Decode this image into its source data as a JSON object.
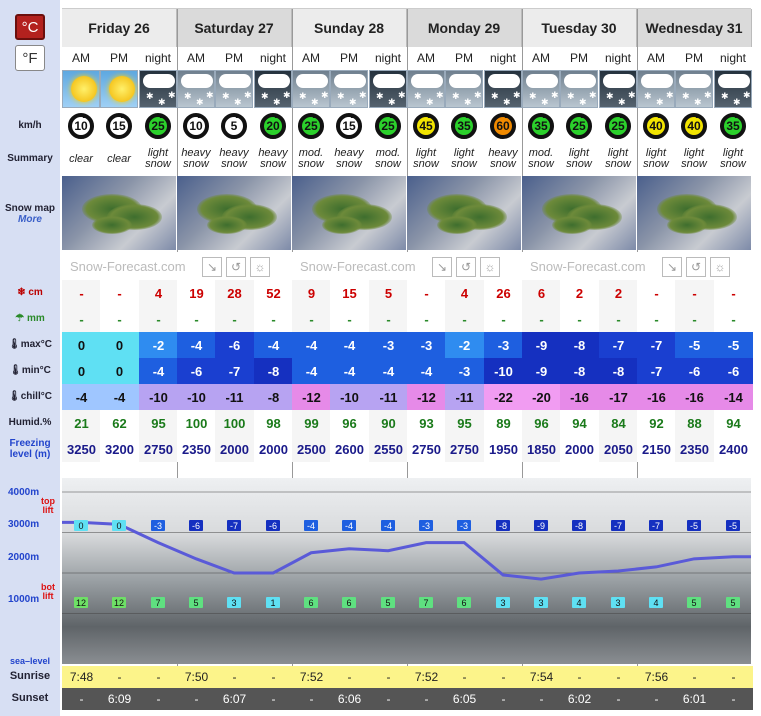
{
  "units": {
    "celsius": "°C",
    "fahrenheit": "°F"
  },
  "labels": {
    "wind": "km/h",
    "summary": "Summary",
    "snowmap": "Snow map",
    "more": "More",
    "snow": "cm",
    "rain": "mm",
    "max": "max°C",
    "min": "min°C",
    "chill": "chill°C",
    "humid": "Humid.%",
    "freezing": "Freezing level (m)",
    "alt4000": "4000m",
    "alt3000": "3000m",
    "alt2000": "2000m",
    "alt1000": "1000m",
    "top": "top",
    "lift": "lift",
    "bot": "bot",
    "sea": "sea–level",
    "sunrise": "Sunrise",
    "sunset": "Sunset"
  },
  "days": [
    "Friday 26",
    "Saturday 27",
    "Sunday 28",
    "Monday 29",
    "Tuesday 30",
    "Wednesday 31"
  ],
  "periods": [
    "AM",
    "PM",
    "night"
  ],
  "credit": "Snow-Forecast.com",
  "weather": [
    "sun",
    "sun",
    "night",
    "snow",
    "snow",
    "night",
    "snow",
    "snow",
    "night",
    "snow",
    "snow",
    "night",
    "snow",
    "snow",
    "night",
    "snow",
    "snow",
    "night"
  ],
  "wind": [
    "10",
    "15",
    "25",
    "10",
    "5",
    "20",
    "25",
    "15",
    "25",
    "45",
    "35",
    "60",
    "35",
    "25",
    "25",
    "40",
    "40",
    "35"
  ],
  "wind_colors": [
    "#fff",
    "#fff",
    "#2bd12b",
    "#fff",
    "#fff",
    "#2bd12b",
    "#2bd12b",
    "#fff",
    "#2bd12b",
    "#f2e400",
    "#2bd12b",
    "#f08a00",
    "#2bd12b",
    "#2bd12b",
    "#2bd12b",
    "#f2e400",
    "#f2e400",
    "#2bd12b"
  ],
  "summary": [
    "clear",
    "clear",
    "light snow",
    "heavy snow",
    "heavy snow",
    "heavy snow",
    "mod. snow",
    "heavy snow",
    "mod. snow",
    "light snow",
    "light snow",
    "heavy snow",
    "mod. snow",
    "light snow",
    "light snow",
    "light snow",
    "light snow",
    "light snow"
  ],
  "snow": [
    "-",
    "-",
    "4",
    "19",
    "28",
    "52",
    "9",
    "15",
    "5",
    "-",
    "4",
    "26",
    "6",
    "2",
    "2",
    "-",
    "-",
    "-"
  ],
  "rain": [
    "-",
    "-",
    "-",
    "-",
    "-",
    "-",
    "-",
    "-",
    "-",
    "-",
    "-",
    "-",
    "-",
    "-",
    "-",
    "-",
    "-",
    "-"
  ],
  "max": [
    "0",
    "0",
    "-2",
    "-4",
    "-6",
    "-4",
    "-4",
    "-4",
    "-3",
    "-3",
    "-2",
    "-3",
    "-9",
    "-8",
    "-7",
    "-7",
    "-5",
    "-5"
  ],
  "min": [
    "0",
    "0",
    "-4",
    "-6",
    "-7",
    "-8",
    "-4",
    "-4",
    "-4",
    "-4",
    "-3",
    "-10",
    "-9",
    "-8",
    "-8",
    "-7",
    "-6",
    "-6"
  ],
  "chill": [
    "-4",
    "-4",
    "-10",
    "-10",
    "-11",
    "-8",
    "-12",
    "-10",
    "-11",
    "-12",
    "-11",
    "-22",
    "-20",
    "-16",
    "-17",
    "-16",
    "-16",
    "-14"
  ],
  "humid": [
    "21",
    "62",
    "95",
    "100",
    "100",
    "98",
    "99",
    "96",
    "90",
    "93",
    "95",
    "89",
    "96",
    "94",
    "84",
    "92",
    "88",
    "94"
  ],
  "freezing": [
    "3250",
    "3200",
    "2750",
    "2350",
    "2000",
    "2000",
    "2500",
    "2600",
    "2550",
    "2750",
    "2750",
    "1950",
    "1850",
    "2000",
    "2050",
    "2150",
    "2350",
    "2400"
  ],
  "toplift": [
    "0",
    "0",
    "-3",
    "-6",
    "-7",
    "-6",
    "-4",
    "-4",
    "-4",
    "-3",
    "-3",
    "-8",
    "-9",
    "-8",
    "-7",
    "-7",
    "-5",
    "-5"
  ],
  "botlift": [
    "12",
    "12",
    "7",
    "5",
    "3",
    "1",
    "6",
    "6",
    "5",
    "7",
    "6",
    "3",
    "3",
    "4",
    "3",
    "4",
    "5",
    "5"
  ],
  "sunrise": [
    "7:48",
    "-",
    "-",
    "7:50",
    "-",
    "-",
    "7:52",
    "-",
    "-",
    "7:52",
    "-",
    "-",
    "7:54",
    "-",
    "-",
    "7:56",
    "-",
    "-"
  ],
  "sunset": [
    "-",
    "6:09",
    "-",
    "-",
    "6:07",
    "-",
    "-",
    "6:06",
    "-",
    "-",
    "6:05",
    "-",
    "-",
    "6:02",
    "-",
    "-",
    "6:01",
    "-"
  ]
}
